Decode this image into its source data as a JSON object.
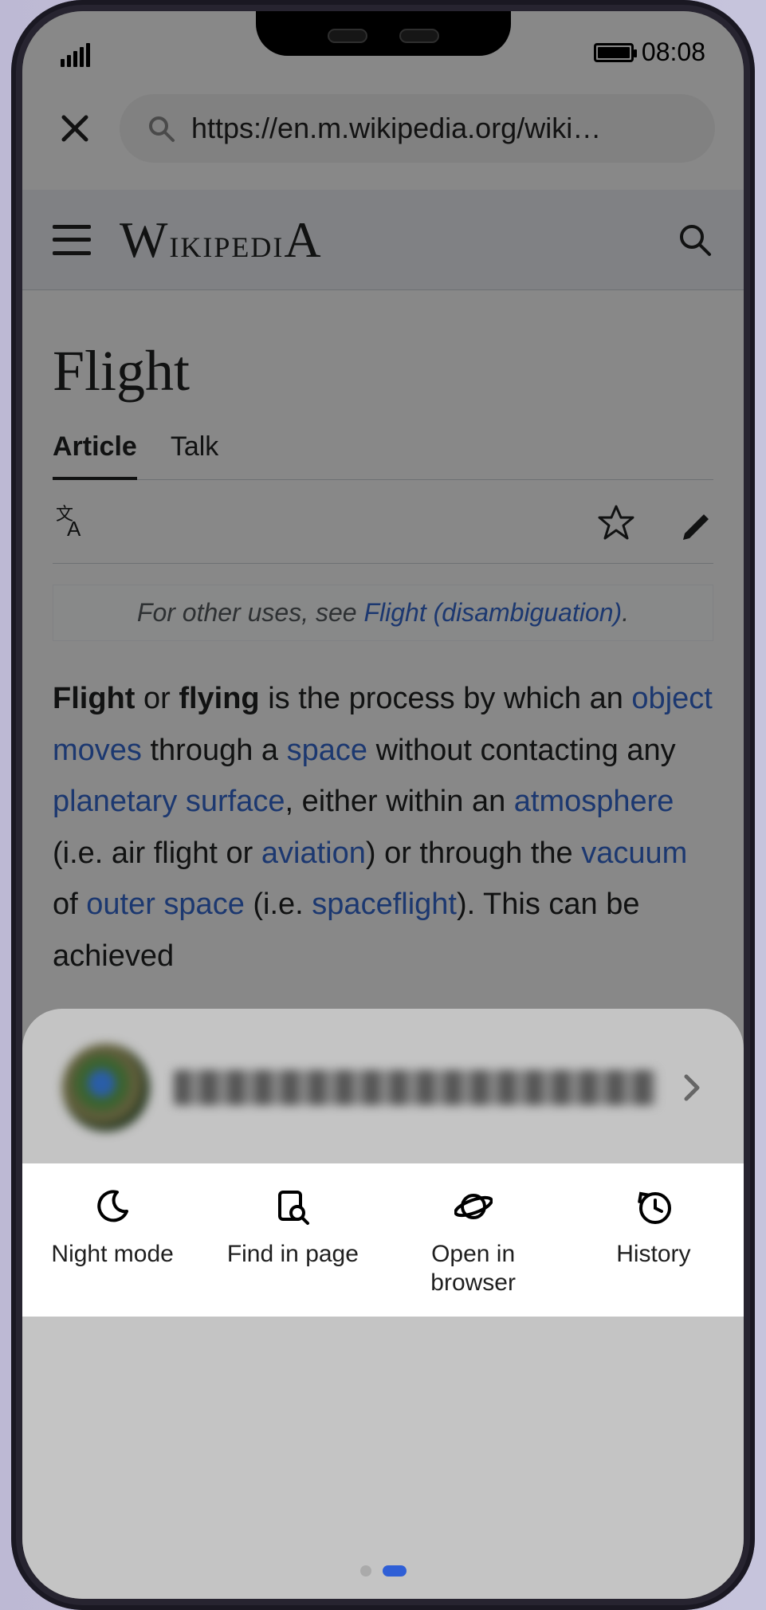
{
  "status": {
    "time": "08:08"
  },
  "browser": {
    "url": "https://en.m.wikipedia.org/wiki…"
  },
  "wikipedia": {
    "site_name_html": "<span class='cap'>W</span>ikipedi<span class='cap'>A</span>",
    "title": "Flight",
    "tabs": [
      "Article",
      "Talk"
    ],
    "active_tab": 0,
    "hatnote_prefix": "For other uses, see ",
    "hatnote_link": "Flight (disambiguation)",
    "hatnote_suffix": ".",
    "body_html": "<b>Flight</b> or <b>flying</b> is the process by which an <a>object</a> <a>moves</a> through a <a>space</a> without contacting any <a>planetary surface</a>, either within an <a>atmosphere</a> (i.e. air flight or <a>aviation</a>) or through the <a>vacuum</a> of <a>outer space</a> (i.e. <a>spaceflight</a>). This can be achieved"
  },
  "sheet": {
    "actions": [
      {
        "id": "night-mode",
        "label": "Night mode"
      },
      {
        "id": "find-in-page",
        "label": "Find in page"
      },
      {
        "id": "open-in-browser",
        "label": "Open in\nbrowser"
      },
      {
        "id": "history",
        "label": "History"
      }
    ]
  }
}
